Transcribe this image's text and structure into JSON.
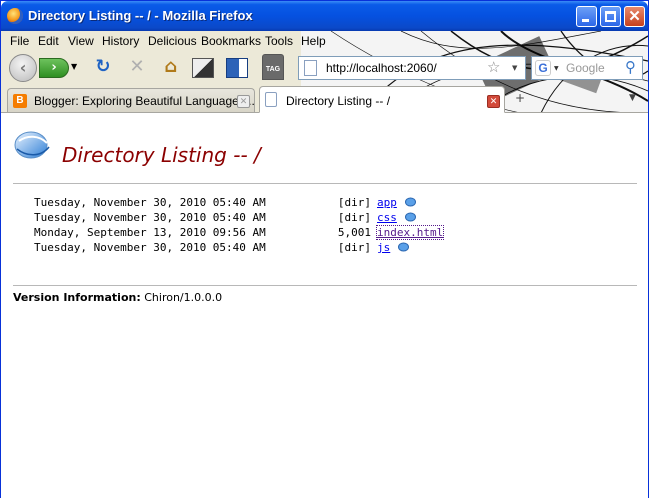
{
  "window": {
    "title": "Directory Listing -- / - Mozilla Firefox"
  },
  "menu": [
    "File",
    "Edit",
    "View",
    "History",
    "Delicious",
    "Bookmarks",
    "Tools",
    "Help"
  ],
  "navbar": {
    "url": "http://localhost:2060/",
    "search_placeholder": "Google",
    "tag_label": "TAG"
  },
  "tabs": [
    {
      "label": "Blogger: Exploring Beautiful Languages...",
      "active": false
    },
    {
      "label": "Directory Listing -- /",
      "active": true
    }
  ],
  "page": {
    "title": "Directory Listing -- /",
    "entries": [
      {
        "date": "Tuesday, November 30, 2010 05:40 AM",
        "size": "[dir]",
        "name": "app"
      },
      {
        "date": "Tuesday, November 30, 2010 05:40 AM",
        "size": "[dir]",
        "name": "css"
      },
      {
        "date": "Monday, September 13, 2010 09:56 AM",
        "size": "5,001",
        "name": "index.html"
      },
      {
        "date": "Tuesday, November 30, 2010 05:40 AM",
        "size": "[dir]",
        "name": "js"
      }
    ],
    "version_label": "Version Information:",
    "version_value": "Chiron/1.0.0.0"
  },
  "colors": {
    "title": "#8b0000",
    "link": "#0000ee",
    "titlebar": "#0551e0"
  }
}
